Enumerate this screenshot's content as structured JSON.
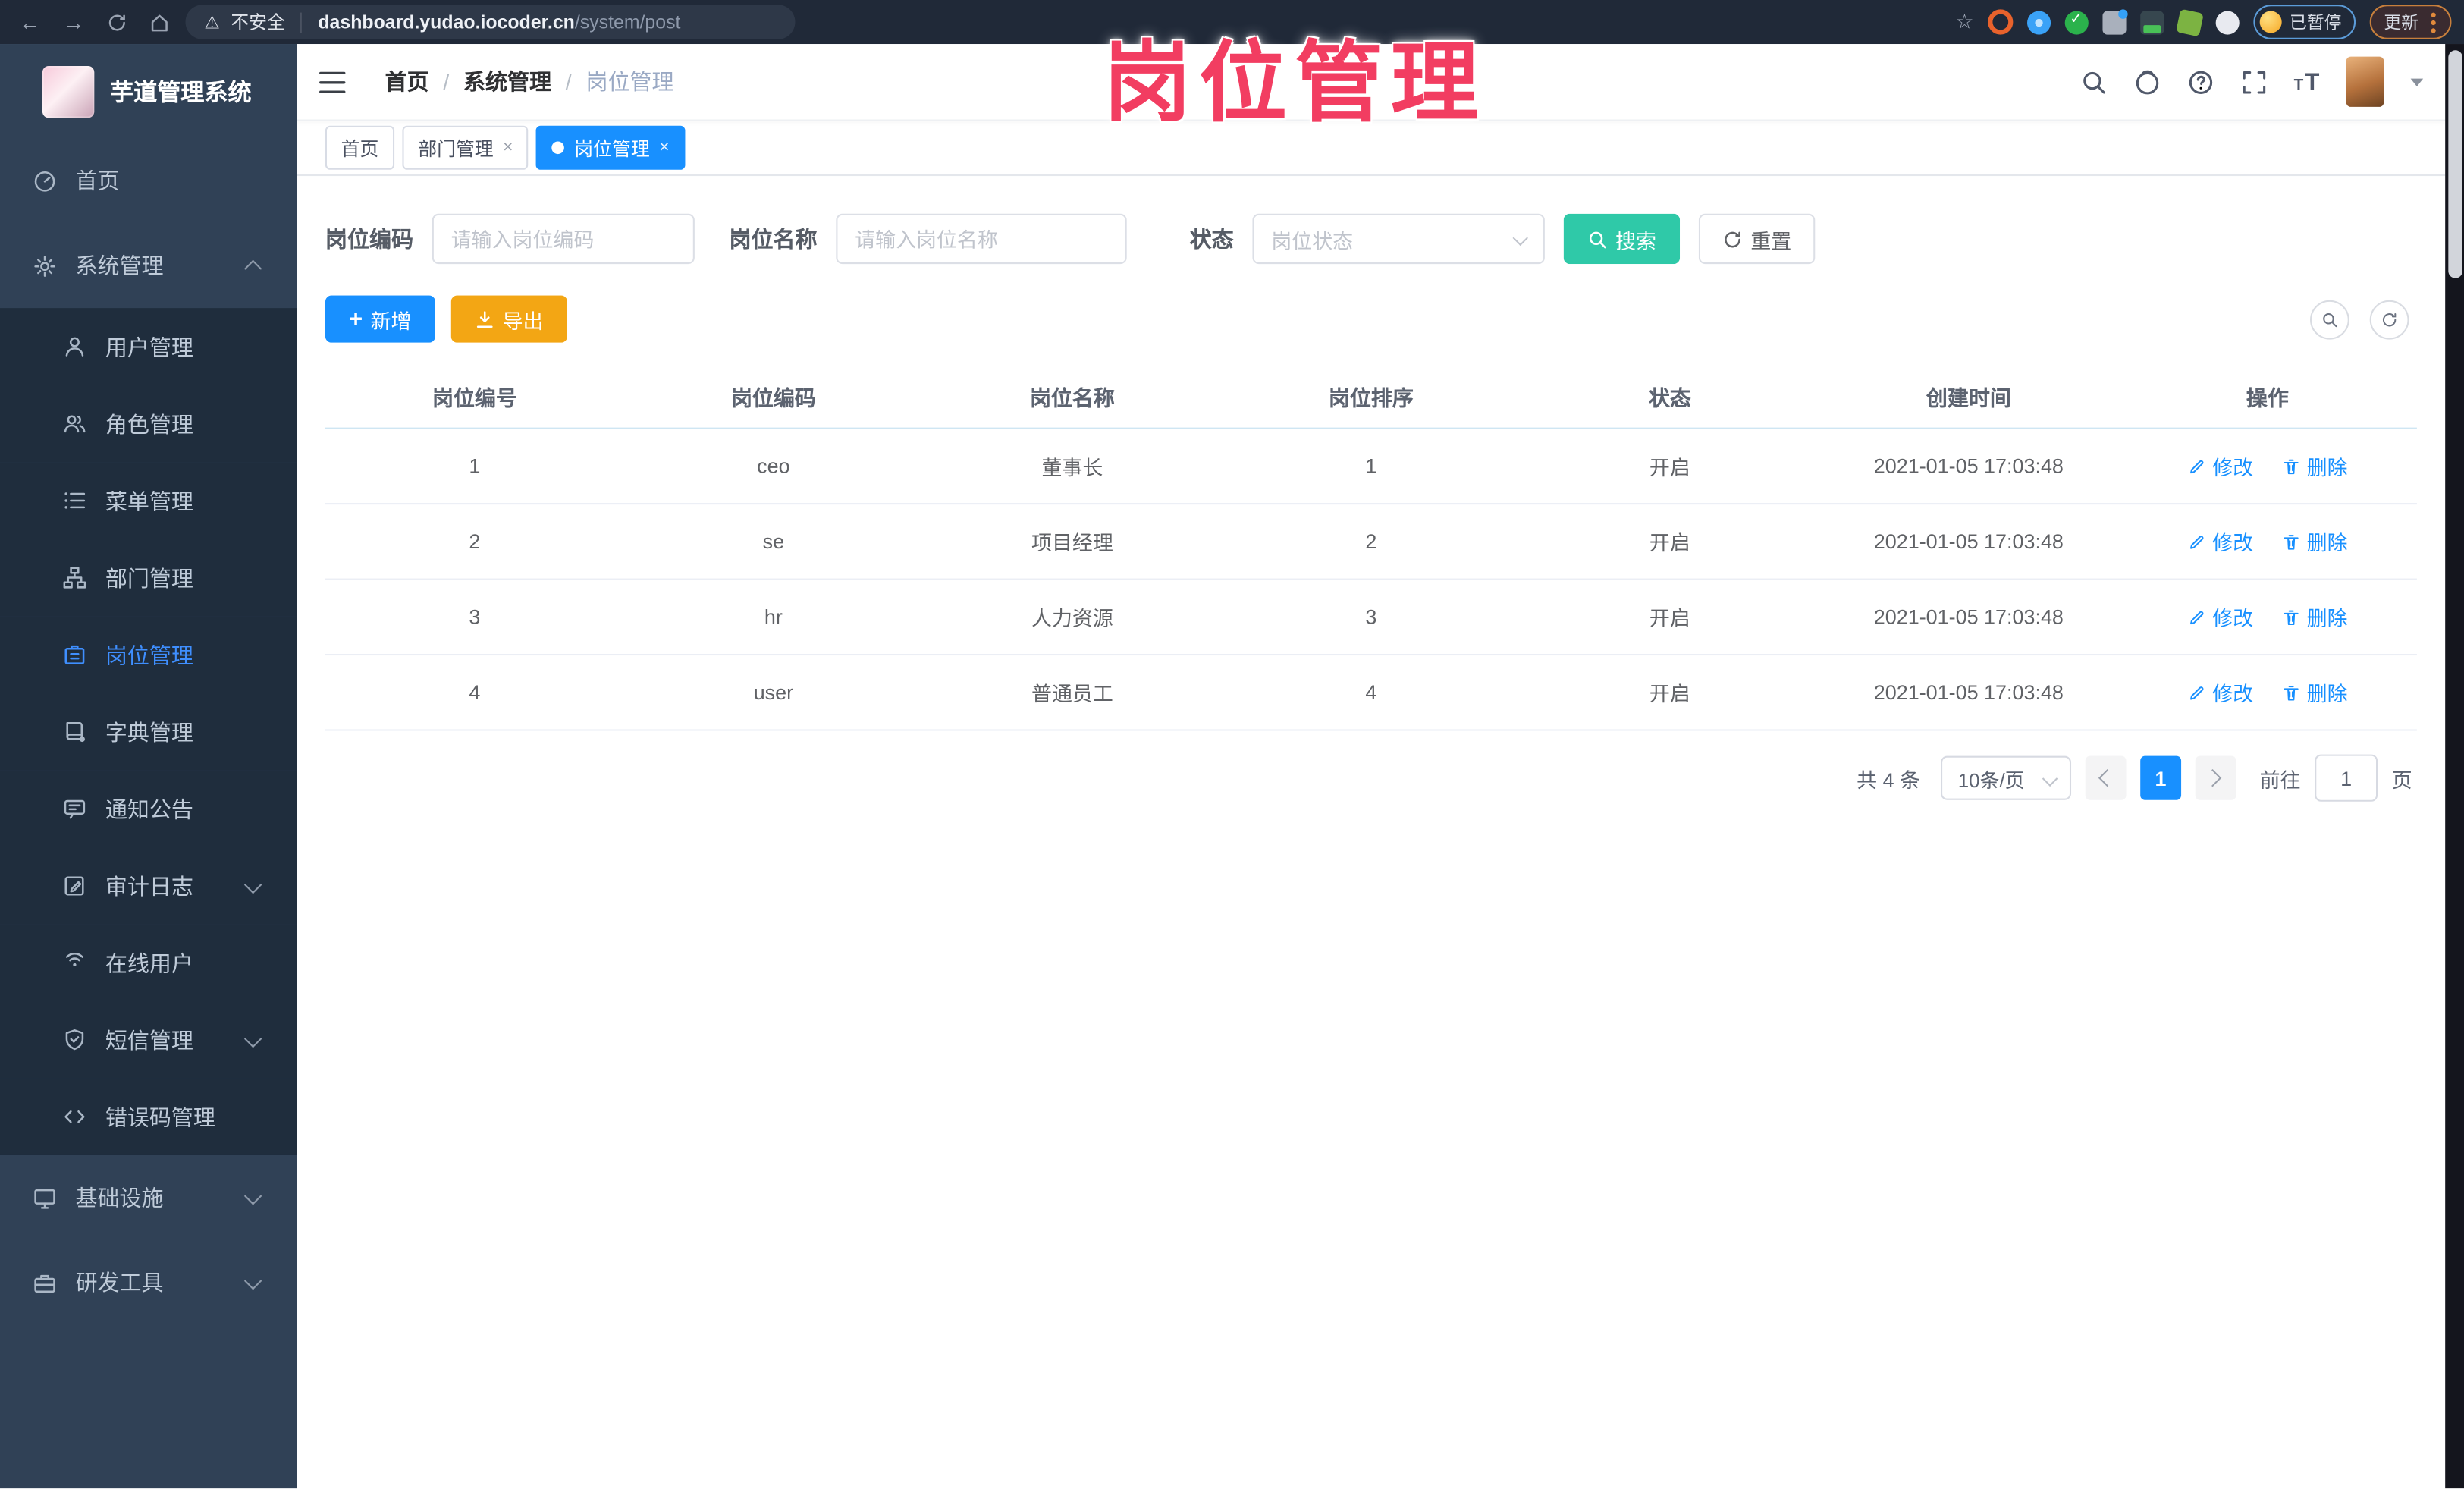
{
  "browser": {
    "security_label": "不安全",
    "url_domain": "dashboard.yudao.iocoder.cn",
    "url_path": "/system/post",
    "paused_badge": "已暂停",
    "update_button": "更新"
  },
  "overlay": {
    "title": "岗位管理"
  },
  "sidebar": {
    "logo_title": "芋道管理系统",
    "items": [
      {
        "label": "首页"
      },
      {
        "label": "系统管理"
      },
      {
        "label": "用户管理"
      },
      {
        "label": "角色管理"
      },
      {
        "label": "菜单管理"
      },
      {
        "label": "部门管理"
      },
      {
        "label": "岗位管理"
      },
      {
        "label": "字典管理"
      },
      {
        "label": "通知公告"
      },
      {
        "label": "审计日志"
      },
      {
        "label": "在线用户"
      },
      {
        "label": "短信管理"
      },
      {
        "label": "错误码管理"
      },
      {
        "label": "基础设施"
      },
      {
        "label": "研发工具"
      }
    ]
  },
  "header": {
    "breadcrumb": [
      "首页",
      "系统管理",
      "岗位管理"
    ],
    "separator": "/"
  },
  "tabs": [
    {
      "label": "首页"
    },
    {
      "label": "部门管理",
      "close": "×"
    },
    {
      "label": "岗位管理",
      "close": "×"
    }
  ],
  "filters": {
    "post_code_label": "岗位编码",
    "post_code_placeholder": "请输入岗位编码",
    "post_name_label": "岗位名称",
    "post_name_placeholder": "请输入岗位名称",
    "status_label": "状态",
    "status_placeholder": "岗位状态",
    "search_label": "搜索",
    "reset_label": "重置"
  },
  "toolbar": {
    "add_label": "新增",
    "export_label": "导出"
  },
  "table": {
    "headers": [
      "岗位编号",
      "岗位编码",
      "岗位名称",
      "岗位排序",
      "状态",
      "创建时间",
      "操作"
    ],
    "op_edit": "修改",
    "op_delete": "删除",
    "rows": [
      {
        "id": "1",
        "code": "ceo",
        "name": "董事长",
        "sort": "1",
        "status": "开启",
        "created": "2021-01-05 17:03:48"
      },
      {
        "id": "2",
        "code": "se",
        "name": "项目经理",
        "sort": "2",
        "status": "开启",
        "created": "2021-01-05 17:03:48"
      },
      {
        "id": "3",
        "code": "hr",
        "name": "人力资源",
        "sort": "3",
        "status": "开启",
        "created": "2021-01-05 17:03:48"
      },
      {
        "id": "4",
        "code": "user",
        "name": "普通员工",
        "sort": "4",
        "status": "开启",
        "created": "2021-01-05 17:03:48"
      }
    ]
  },
  "pagination": {
    "total": "共 4 条",
    "page_size": "10条/页",
    "current_page": "1",
    "goto_label": "前往",
    "goto_value": "1",
    "page_unit": "页"
  },
  "colors": {
    "primary_blue": "#1890ff",
    "search_teal": "#2fc9a8",
    "export_orange": "#f3a614",
    "sidebar_bg": "#304156",
    "submenu_bg": "#1f2d3d",
    "overlay_pink": "#f23d61",
    "browser_bar_bg": "#202938"
  }
}
